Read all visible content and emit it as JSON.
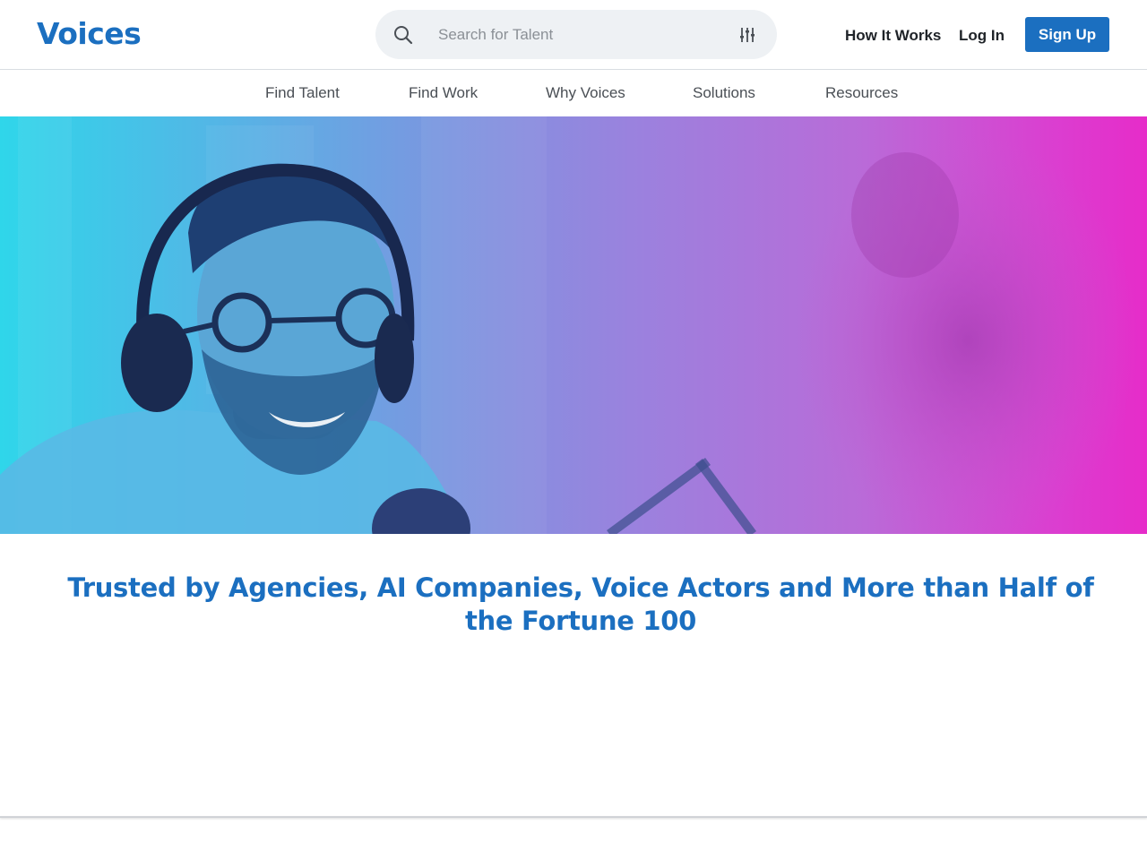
{
  "header": {
    "logo_text": "Voices",
    "search": {
      "placeholder": "Search for Talent",
      "value": "",
      "icon": "search-icon",
      "filter_icon": "filter-sliders-icon"
    },
    "links": {
      "how_it_works": "How It Works",
      "log_in": "Log In"
    },
    "sign_up_label": "Sign Up"
  },
  "subnav": {
    "items": [
      {
        "label": "Find Talent"
      },
      {
        "label": "Find Work"
      },
      {
        "label": "Why Voices"
      },
      {
        "label": "Solutions"
      },
      {
        "label": "Resources"
      }
    ]
  },
  "hero": {
    "image": "smiling man with headphones and glasses at podcast microphone, cyan-to-magenta gradient overlay"
  },
  "trusted": {
    "headline": "Trusted by Agencies, AI Companies, Voice Actors and More than Half of the Fortune 100"
  },
  "colors": {
    "brand": "#1b6fc0",
    "gradient_start": "#2fd6ea",
    "gradient_end": "#e62cc9"
  }
}
